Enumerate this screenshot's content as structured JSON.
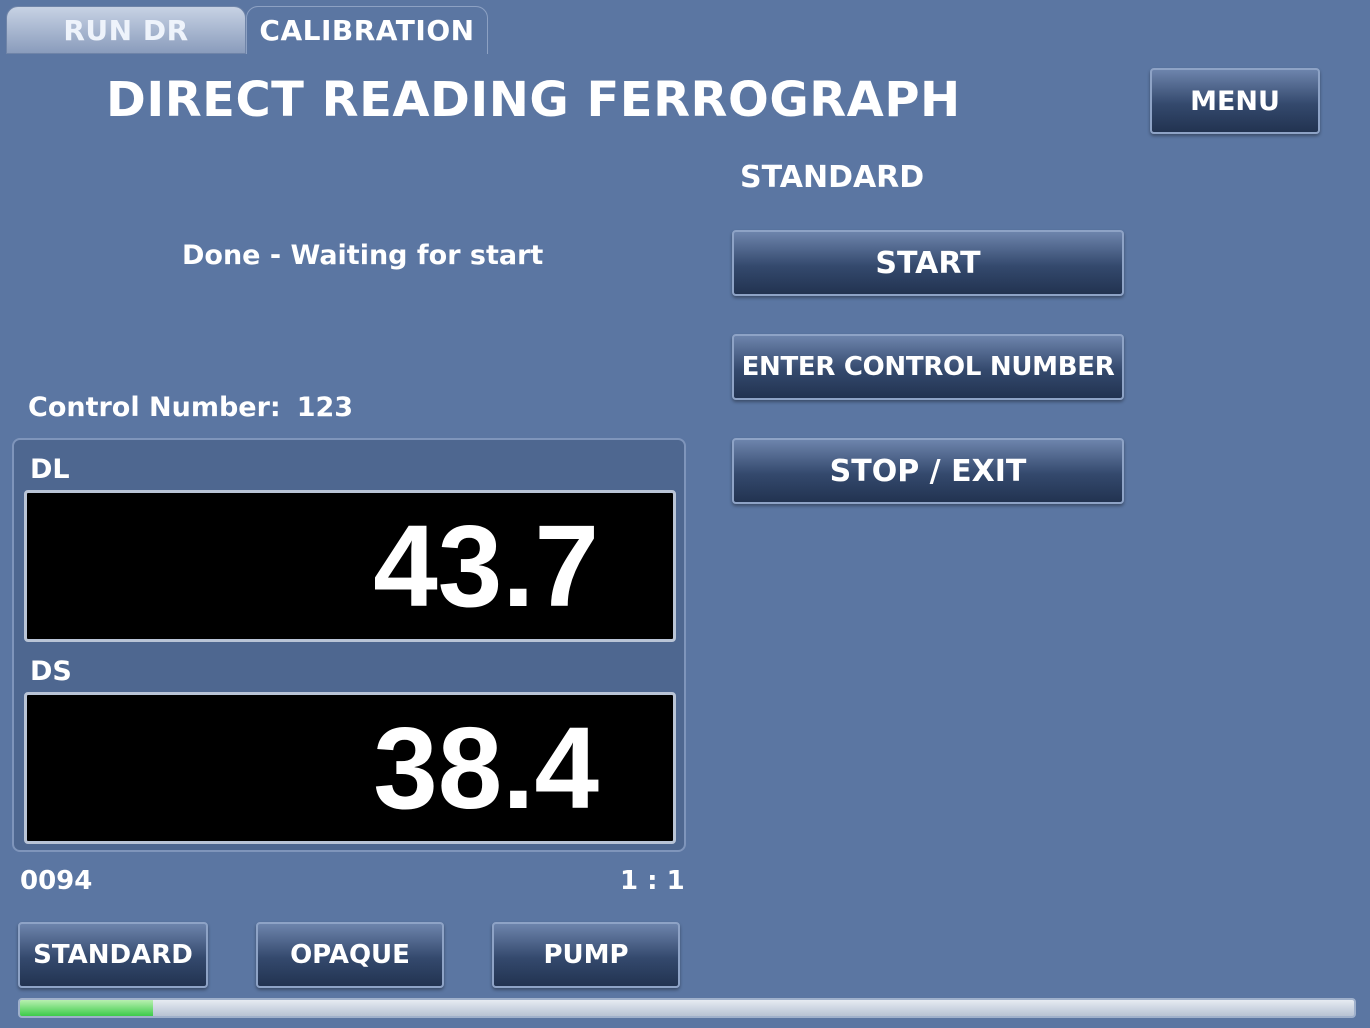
{
  "tabs": [
    {
      "label": "RUN DR",
      "active": false
    },
    {
      "label": "CALIBRATION",
      "active": true
    }
  ],
  "header": {
    "title": "DIRECT READING FERROGRAPH",
    "menu_label": "MENU"
  },
  "mode": "STANDARD",
  "status": "Done - Waiting for start",
  "controls": {
    "start_label": "START",
    "enter_control_label": "ENTER CONTROL NUMBER",
    "stop_exit_label": "STOP / EXIT"
  },
  "control_number": {
    "label": "Control Number:",
    "value": "123"
  },
  "readings": {
    "dl": {
      "label": "DL",
      "value": "43.7"
    },
    "ds": {
      "label": "DS",
      "value": "38.4"
    }
  },
  "footer": {
    "counter": "0094",
    "ratio": "1 : 1",
    "buttons": [
      "STANDARD",
      "OPAQUE",
      "PUMP"
    ]
  },
  "progress": {
    "fraction": 0.1
  },
  "colors": {
    "background": "#5b76a2",
    "button_dark": "#223351",
    "display_bg": "#000000",
    "progress_fill": "#3dcb4a"
  }
}
